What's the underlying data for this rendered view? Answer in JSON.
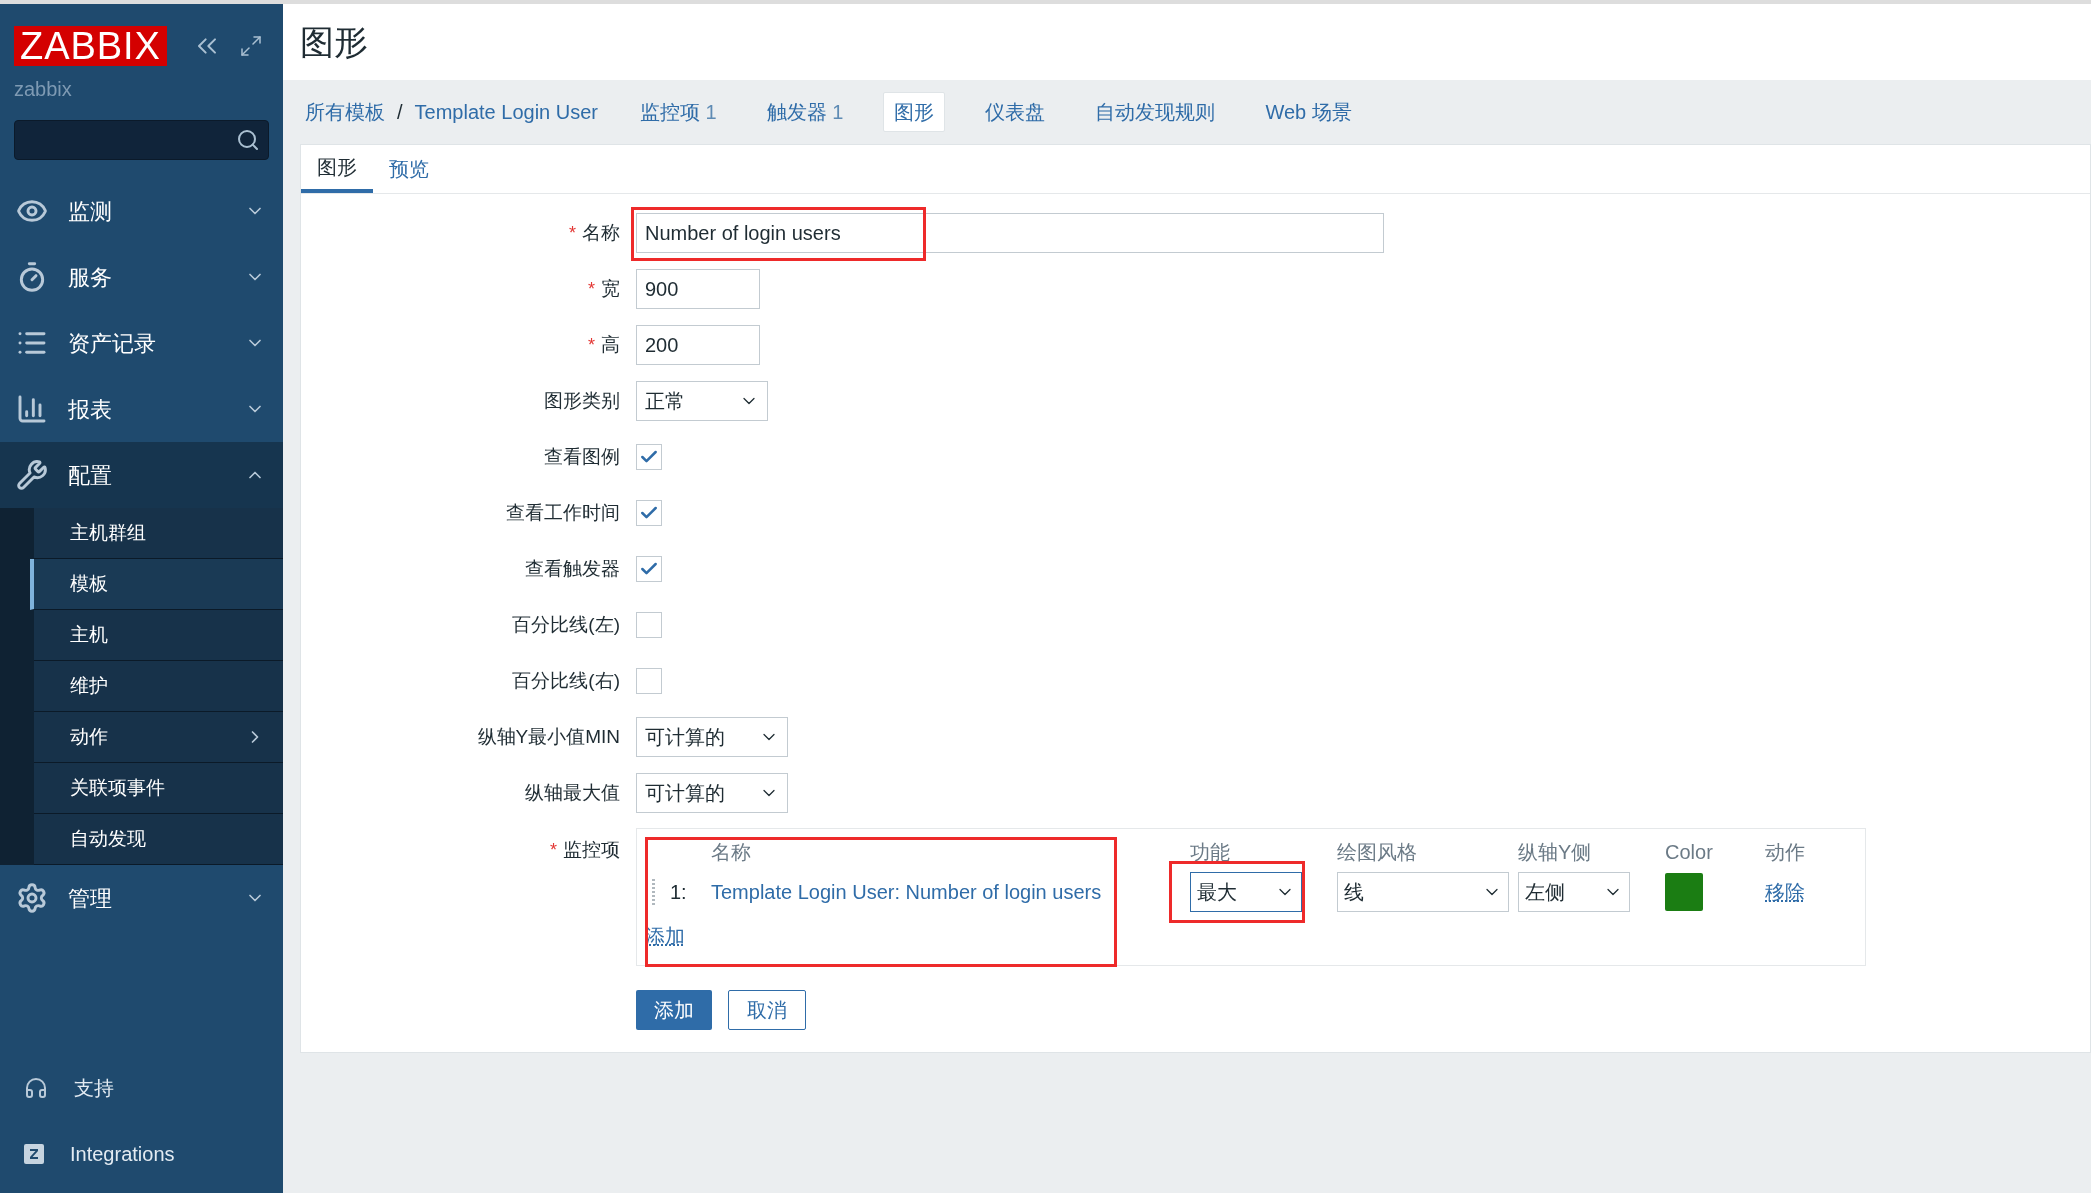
{
  "sidebar": {
    "logo": "ZABBIX",
    "user": "zabbix",
    "menu": [
      {
        "label": "监测",
        "expanded": false
      },
      {
        "label": "服务",
        "expanded": false
      },
      {
        "label": "资产记录",
        "expanded": false
      },
      {
        "label": "报表",
        "expanded": false
      },
      {
        "label": "配置",
        "expanded": true,
        "children": [
          {
            "label": "主机群组",
            "selected": false,
            "has_submenu": false
          },
          {
            "label": "模板",
            "selected": true,
            "has_submenu": false
          },
          {
            "label": "主机",
            "selected": false,
            "has_submenu": false
          },
          {
            "label": "维护",
            "selected": false,
            "has_submenu": false
          },
          {
            "label": "动作",
            "selected": false,
            "has_submenu": true
          },
          {
            "label": "关联项事件",
            "selected": false,
            "has_submenu": false
          },
          {
            "label": "自动发现",
            "selected": false,
            "has_submenu": false
          }
        ]
      },
      {
        "label": "管理",
        "expanded": false
      }
    ],
    "footer": [
      {
        "label": "支持"
      },
      {
        "label": "Integrations"
      }
    ]
  },
  "page_title": "图形",
  "required_mark": "*",
  "breadcrumbs": {
    "items": [
      {
        "label": "所有模板"
      },
      {
        "label": "Template Login User"
      }
    ],
    "separator": "/"
  },
  "nav_tabs": [
    {
      "label": "监控项",
      "count": "1",
      "selected": false
    },
    {
      "label": "触发器",
      "count": "1",
      "selected": false
    },
    {
      "label": "图形",
      "selected": true
    },
    {
      "label": "仪表盘",
      "selected": false
    },
    {
      "label": "自动发现规则",
      "selected": false
    },
    {
      "label": "Web 场景",
      "selected": false
    }
  ],
  "subtabs": [
    {
      "label": "图形",
      "selected": true
    },
    {
      "label": "预览",
      "selected": false
    }
  ],
  "form": [
    {
      "kind": "text",
      "label": "名称",
      "required": true,
      "value": "Number of login users"
    },
    {
      "kind": "text",
      "label": "宽",
      "required": true,
      "value": "900"
    },
    {
      "kind": "text",
      "label": "高",
      "required": true,
      "value": "200"
    },
    {
      "kind": "select",
      "label": "图形类别",
      "required": false,
      "value": "正常"
    },
    {
      "kind": "checkbox",
      "label": "查看图例",
      "required": false,
      "checked": true
    },
    {
      "kind": "checkbox",
      "label": "查看工作时间",
      "required": false,
      "checked": true
    },
    {
      "kind": "checkbox",
      "label": "查看触发器",
      "required": false,
      "checked": true
    },
    {
      "kind": "checkbox",
      "label": "百分比线(左)",
      "required": false,
      "checked": false
    },
    {
      "kind": "checkbox",
      "label": "百分比线(右)",
      "required": false,
      "checked": false
    },
    {
      "kind": "select",
      "label": "纵轴Y最小值MIN",
      "required": false,
      "value": "可计算的"
    },
    {
      "kind": "select",
      "label": "纵轴最大值",
      "required": false,
      "value": "可计算的"
    }
  ],
  "items": {
    "label": "监控项",
    "required": true,
    "columns": [
      "名称",
      "功能",
      "绘图风格",
      "纵轴Y侧",
      "Color",
      "动作"
    ],
    "rows": [
      {
        "index": "1:",
        "name": "Template Login User: Number of login users",
        "function": "最大",
        "style": "线",
        "axis": "左侧",
        "color": "#1b7d13",
        "action": "移除"
      }
    ],
    "add_link": "添加"
  },
  "buttons": [
    {
      "label": "添加",
      "primary": true
    },
    {
      "label": "取消",
      "primary": false
    }
  ]
}
